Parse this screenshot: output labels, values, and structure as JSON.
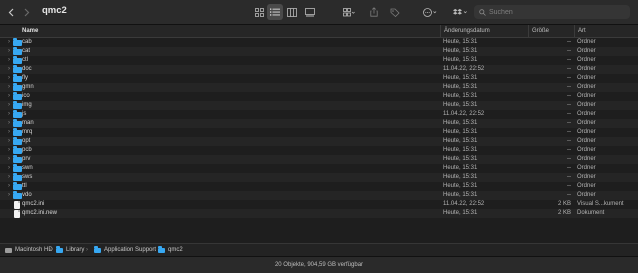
{
  "toolbar": {
    "title": "qmc2",
    "back_icon": "chevron-left-icon",
    "forward_icon": "chevron-right-icon",
    "view_icons": [
      "icon-grid-icon",
      "list-view-icon",
      "column-view-icon",
      "gallery-view-icon"
    ],
    "search_placeholder": "Suchen"
  },
  "columns": {
    "name": "Name",
    "date": "Änderungsdatum",
    "size": "Größe",
    "kind": "Art"
  },
  "rows": [
    {
      "name": "cab",
      "date": "Heute, 15:31",
      "size": "--",
      "kind": "Ordner",
      "type": "folder"
    },
    {
      "name": "cat",
      "date": "Heute, 15:31",
      "size": "--",
      "kind": "Ordner",
      "type": "folder"
    },
    {
      "name": "ctl",
      "date": "Heute, 15:31",
      "size": "--",
      "kind": "Ordner",
      "type": "folder"
    },
    {
      "name": "doc",
      "date": "11.04.22, 22:52",
      "size": "--",
      "kind": "Ordner",
      "type": "folder"
    },
    {
      "name": "fly",
      "date": "Heute, 15:31",
      "size": "--",
      "kind": "Ordner",
      "type": "folder"
    },
    {
      "name": "gmn",
      "date": "Heute, 15:31",
      "size": "--",
      "kind": "Ordner",
      "type": "folder"
    },
    {
      "name": "ico",
      "date": "Heute, 15:31",
      "size": "--",
      "kind": "Ordner",
      "type": "folder"
    },
    {
      "name": "img",
      "date": "Heute, 15:31",
      "size": "--",
      "kind": "Ordner",
      "type": "folder"
    },
    {
      "name": "js",
      "date": "11.04.22, 22:52",
      "size": "--",
      "kind": "Ordner",
      "type": "folder"
    },
    {
      "name": "man",
      "date": "Heute, 15:31",
      "size": "--",
      "kind": "Ordner",
      "type": "folder"
    },
    {
      "name": "mrq",
      "date": "Heute, 15:31",
      "size": "--",
      "kind": "Ordner",
      "type": "folder"
    },
    {
      "name": "opt",
      "date": "Heute, 15:31",
      "size": "--",
      "kind": "Ordner",
      "type": "folder"
    },
    {
      "name": "pcb",
      "date": "Heute, 15:31",
      "size": "--",
      "kind": "Ordner",
      "type": "folder"
    },
    {
      "name": "prv",
      "date": "Heute, 15:31",
      "size": "--",
      "kind": "Ordner",
      "type": "folder"
    },
    {
      "name": "swn",
      "date": "Heute, 15:31",
      "size": "--",
      "kind": "Ordner",
      "type": "folder"
    },
    {
      "name": "sws",
      "date": "Heute, 15:31",
      "size": "--",
      "kind": "Ordner",
      "type": "folder"
    },
    {
      "name": "ttl",
      "date": "Heute, 15:31",
      "size": "--",
      "kind": "Ordner",
      "type": "folder"
    },
    {
      "name": "vdo",
      "date": "Heute, 15:31",
      "size": "--",
      "kind": "Ordner",
      "type": "folder"
    },
    {
      "name": "qmc2.ini",
      "date": "11.04.22, 22:52",
      "size": "2 KB",
      "kind": "Visual S...kument",
      "type": "file"
    },
    {
      "name": "qmc2.ini.new",
      "date": "Heute, 15:31",
      "size": "2 KB",
      "kind": "Dokument",
      "type": "file"
    }
  ],
  "pathbar": [
    "Macintosh HD",
    "Library",
    "Application Support",
    "qmc2"
  ],
  "status": "20 Objekte, 904,59 GB verfügbar",
  "colors": {
    "folder": "#37a8f2",
    "background": "#1e1e1e"
  }
}
